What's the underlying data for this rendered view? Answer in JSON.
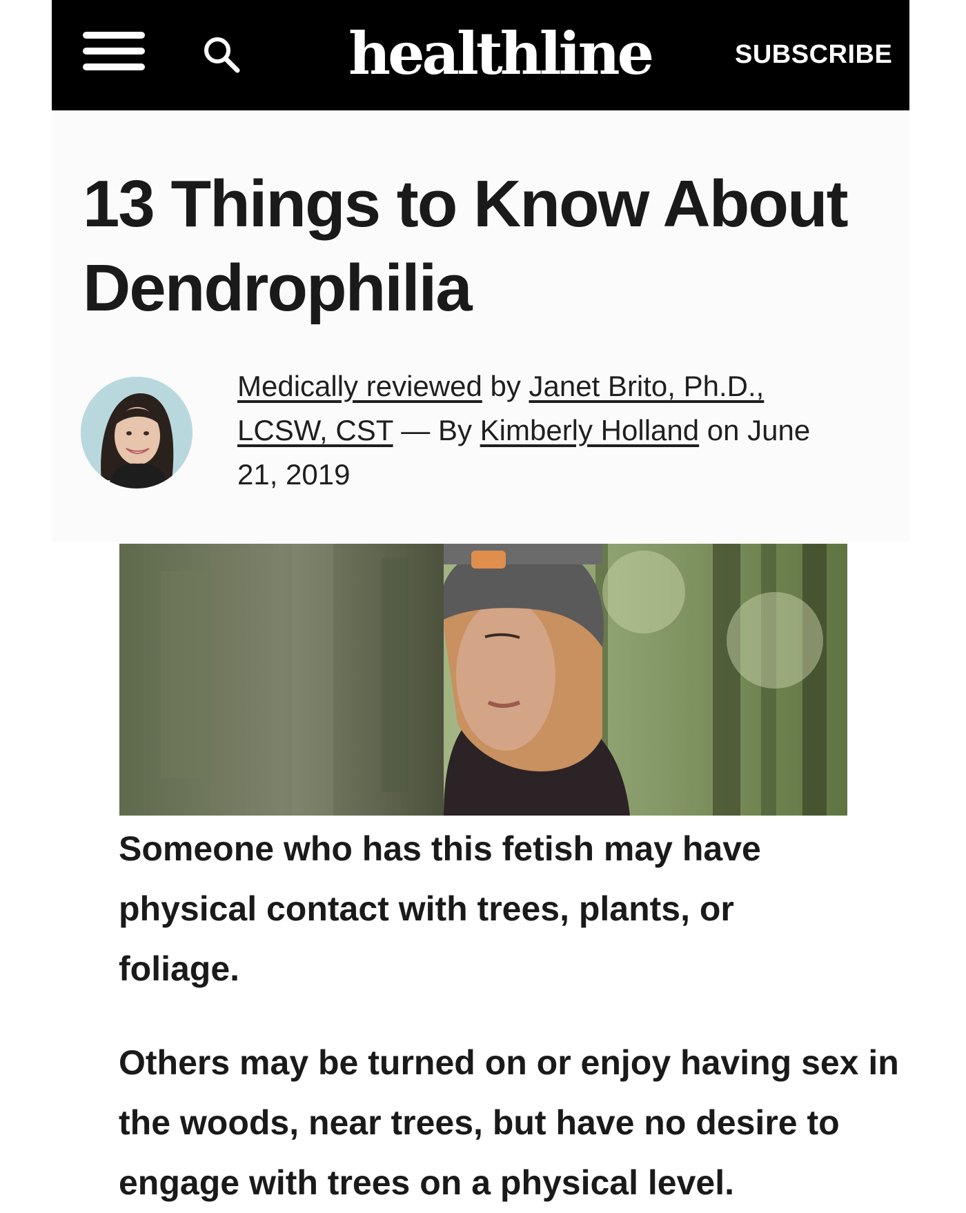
{
  "header": {
    "menu_icon": "hamburger-menu-icon",
    "search_icon": "search-icon",
    "logo_text": "healthline",
    "subscribe_label": "SUBSCRIBE",
    "background_color": "#000000"
  },
  "article": {
    "title": "13 Things to Know About Dendrophilia",
    "byline": {
      "reviewed_link": "Medically reviewed",
      "by_text": " by ",
      "reviewer_name": "Janet Brito, Ph.D., LCSW, CST",
      "separator": " — By ",
      "author_name": "Kimberly Holland",
      "date_text": " on June 21, 2019"
    },
    "caption": "Someone who has this fetish may have physical contact with trees, plants, or foliage.",
    "paragraph": "Others may be turned on or enjoy having sex in the woods, near trees, but have no desire to engage with trees on a physical level."
  }
}
